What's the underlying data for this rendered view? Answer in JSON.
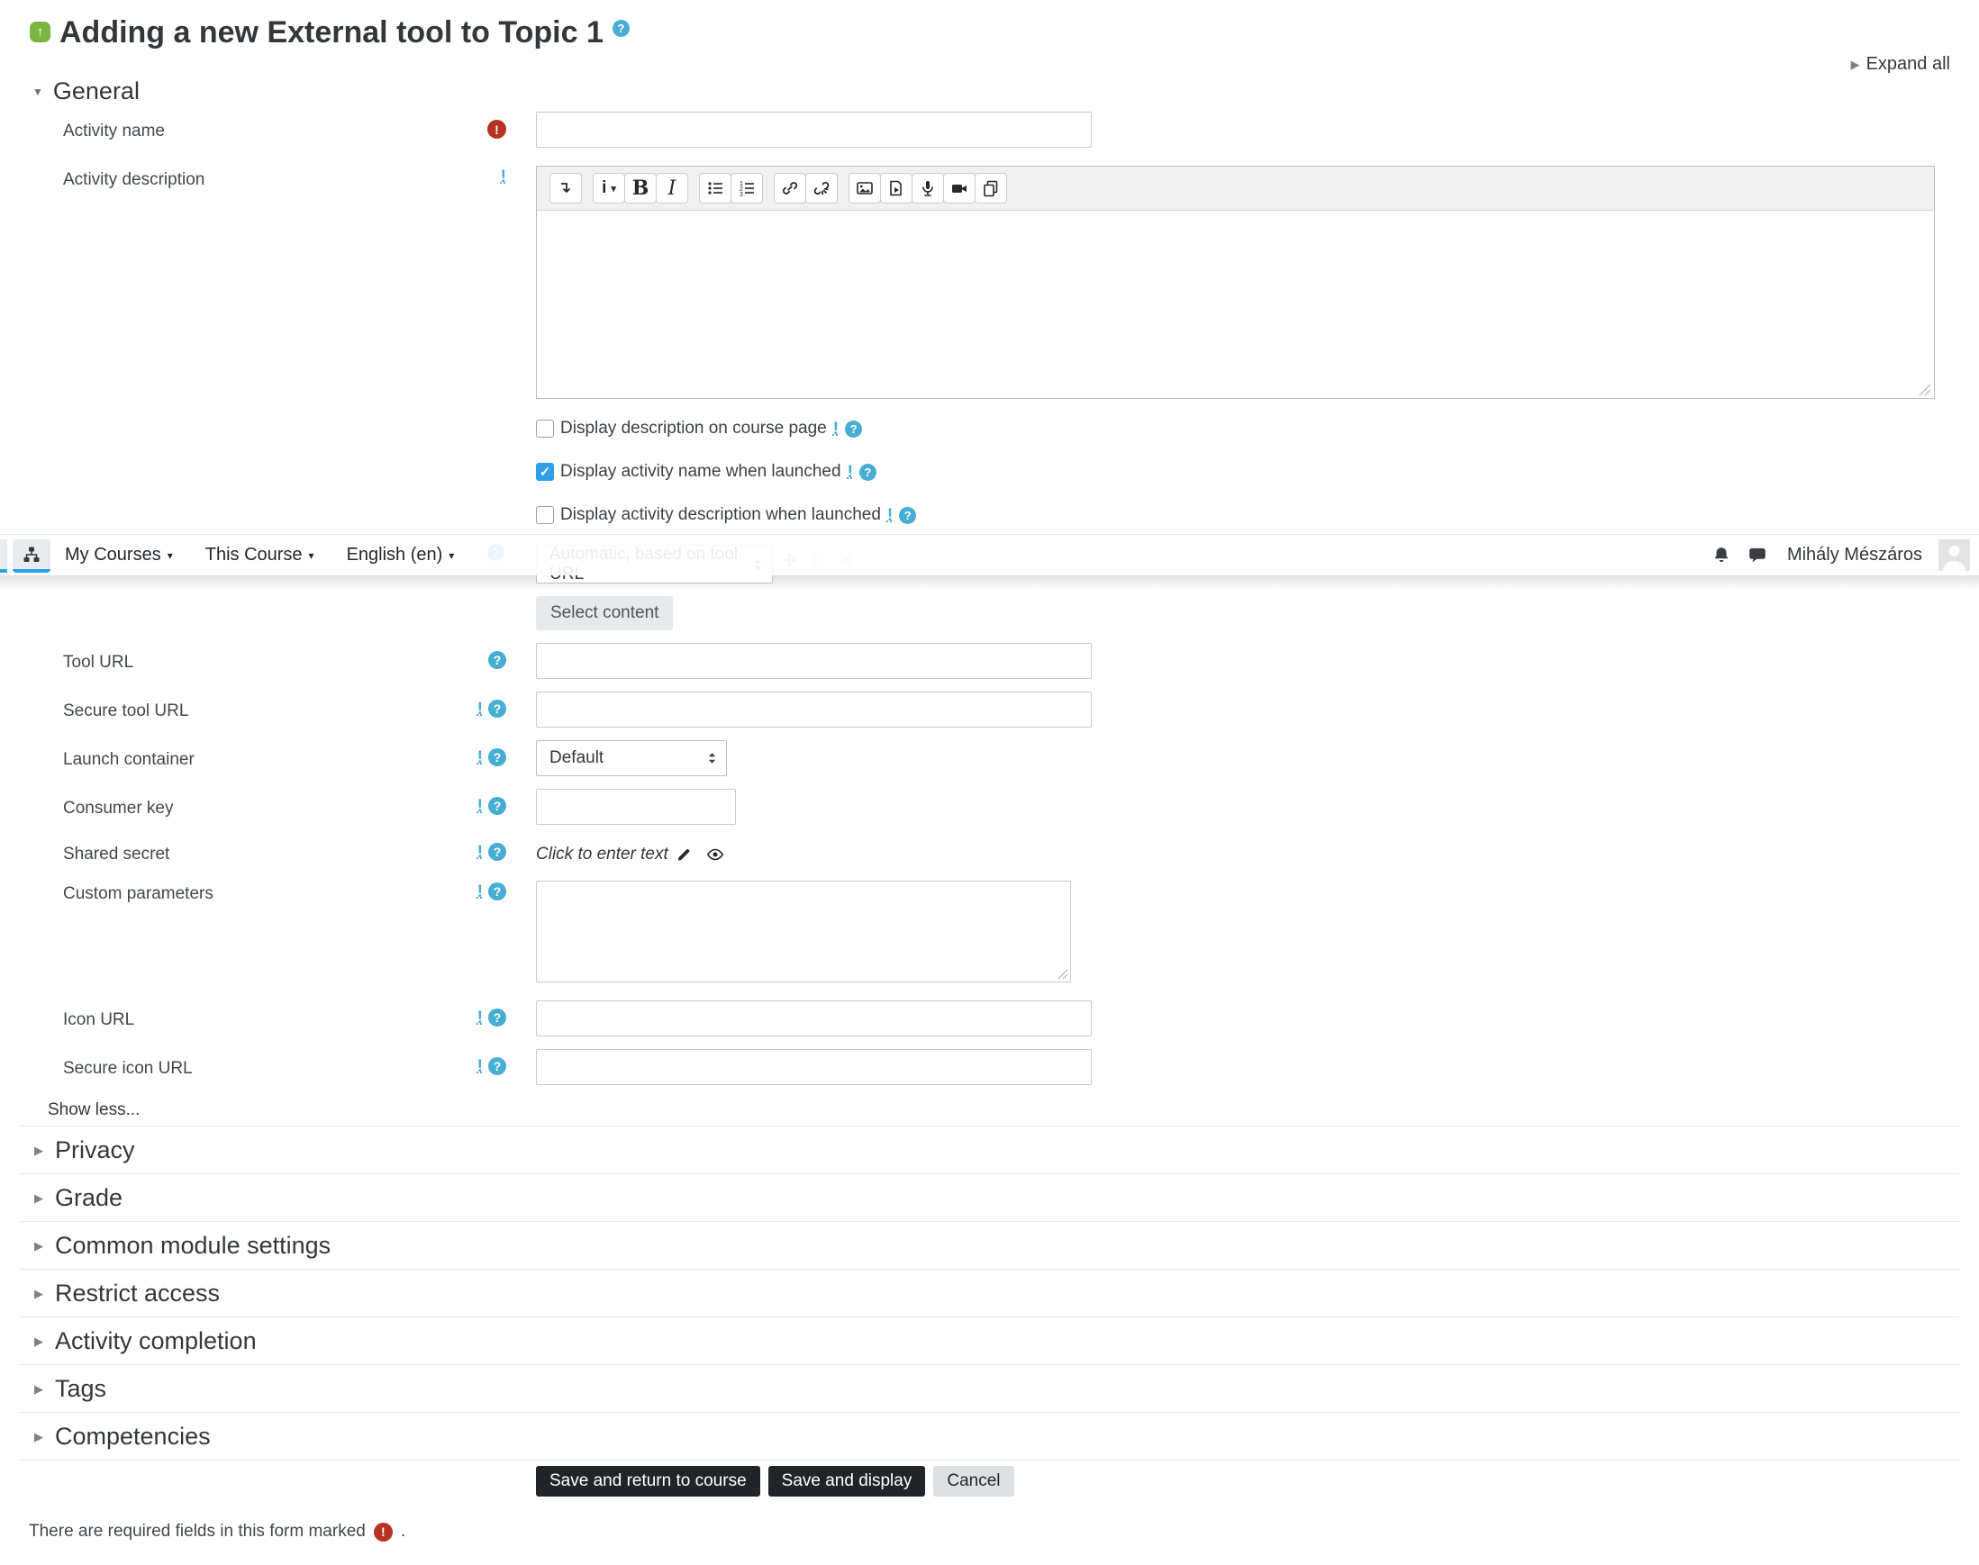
{
  "header": {
    "title": "Adding a new External tool to Topic 1",
    "expand_all": "Expand all"
  },
  "navbar": {
    "items": [
      {
        "label": "My Courses"
      },
      {
        "label": "This Course"
      },
      {
        "label": "English (en)"
      }
    ],
    "icons": [
      "sitemap-icon",
      "bell-icon",
      "chat-icon"
    ],
    "user_name": "Mihály Mészáros"
  },
  "general": {
    "heading": "General",
    "activity_name": {
      "label": "Activity name",
      "value": "",
      "required": true
    },
    "activity_description": {
      "label": "Activity description",
      "value": ""
    },
    "editor_toolbar_icons": [
      "collapse-toolbar-icon",
      "paragraph-styles-icon",
      "bold-icon",
      "italic-icon",
      "unordered-list-icon",
      "ordered-list-icon",
      "link-icon",
      "unlink-icon",
      "insert-image-icon",
      "insert-media-icon",
      "record-audio-icon",
      "record-video-icon",
      "manage-files-icon"
    ],
    "checkboxes": [
      {
        "label": "Display description on course page",
        "checked": false
      },
      {
        "label": "Display activity name when launched",
        "checked": true
      },
      {
        "label": "Display activity description when launched",
        "checked": false
      }
    ],
    "preconfigured_tool": {
      "select_value": "Automatic, based on tool URL"
    },
    "select_content_button": "Select content",
    "fields": [
      {
        "label": "Tool URL",
        "type": "text",
        "value": ""
      },
      {
        "label": "Secure tool URL",
        "type": "text",
        "value": ""
      },
      {
        "label": "Launch container",
        "type": "select",
        "value": "Default"
      },
      {
        "label": "Consumer key",
        "type": "text",
        "value": ""
      },
      {
        "label": "Shared secret",
        "type": "secret",
        "value": "Click to enter text"
      },
      {
        "label": "Custom parameters",
        "type": "textarea",
        "value": ""
      },
      {
        "label": "Icon URL",
        "type": "text",
        "value": ""
      },
      {
        "label": "Secure icon URL",
        "type": "text",
        "value": ""
      }
    ],
    "show_less": "Show less..."
  },
  "sections": [
    {
      "label": "Privacy"
    },
    {
      "label": "Grade"
    },
    {
      "label": "Common module settings"
    },
    {
      "label": "Restrict access"
    },
    {
      "label": "Activity completion"
    },
    {
      "label": "Tags"
    },
    {
      "label": "Competencies"
    }
  ],
  "actions": {
    "save_return": "Save and return to course",
    "save_display": "Save and display",
    "cancel": "Cancel"
  },
  "footer": {
    "required_note": "There are required fields in this form marked",
    "suffix": "."
  },
  "colors": {
    "accent_blue": "#2b9fe8",
    "help_blue": "#47aed3",
    "required_red": "#b73220",
    "button_dark": "#212529",
    "activity_icon_green": "#7db63e"
  }
}
